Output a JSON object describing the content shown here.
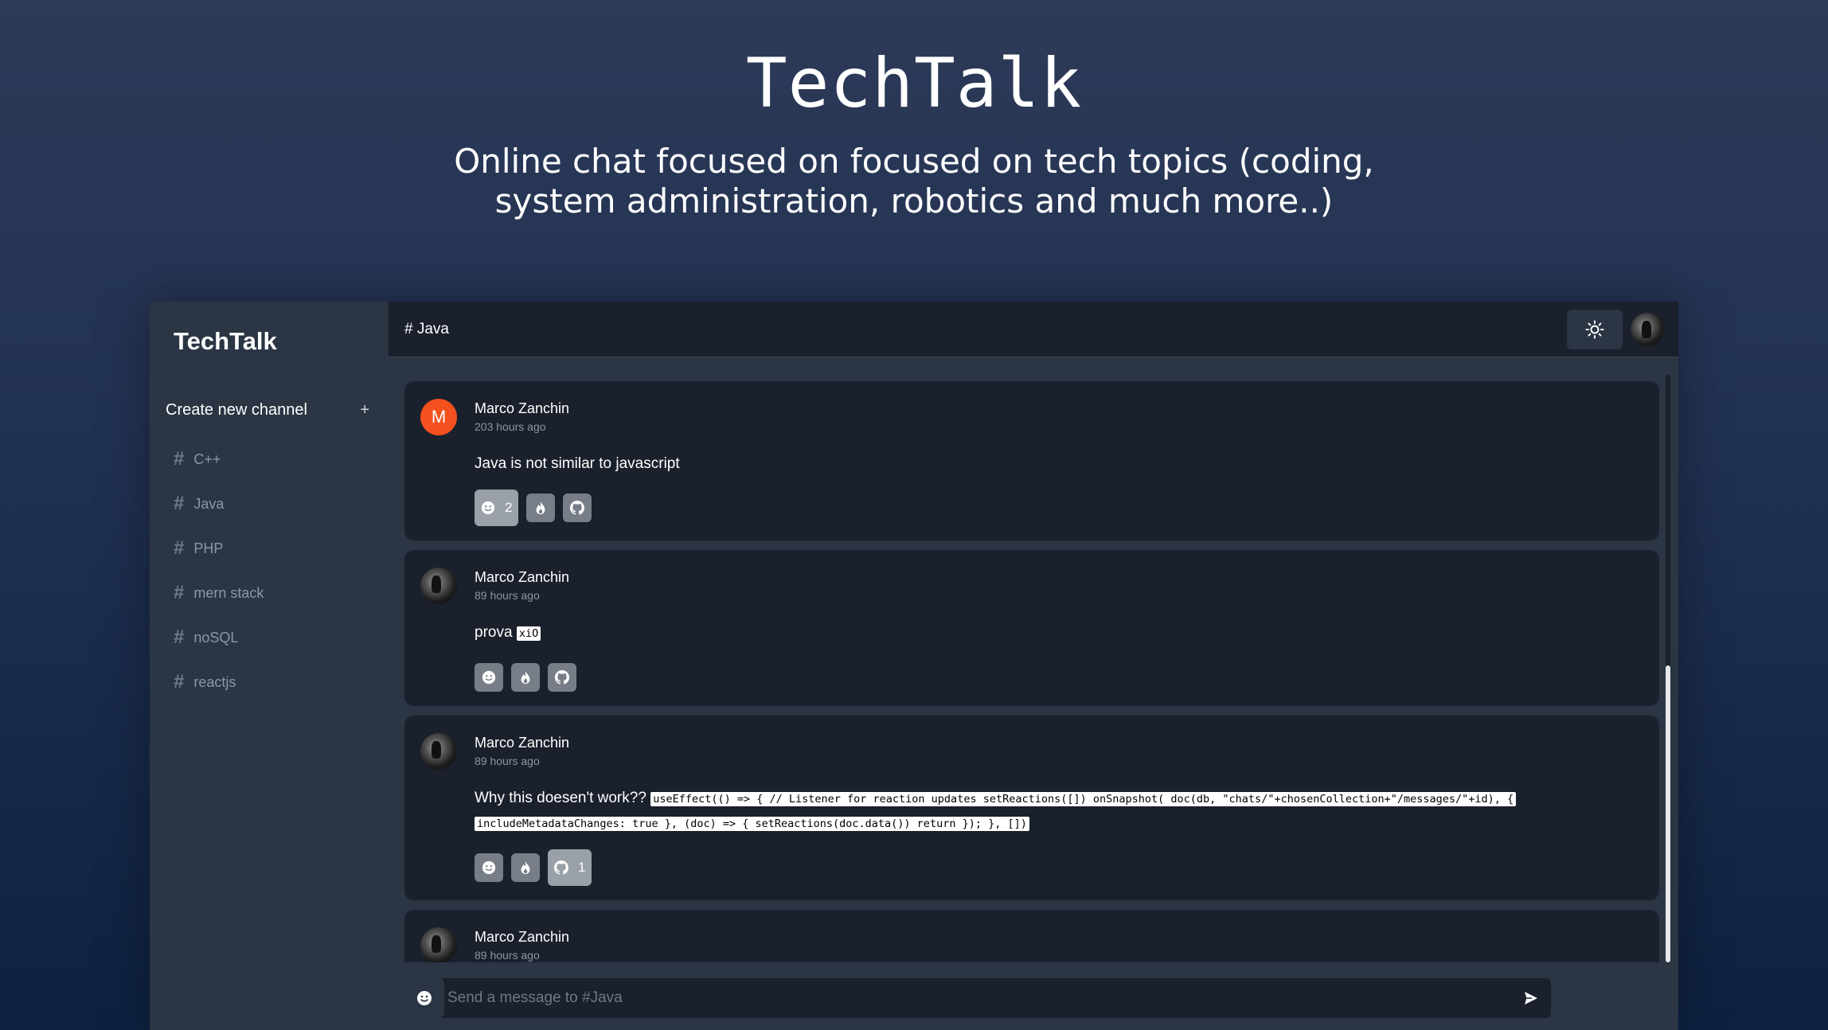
{
  "hero": {
    "title": "TechTalk",
    "subtitle": "Online chat focused on focused on tech topics (coding, system administration, robotics and much more..)"
  },
  "sidebar": {
    "brand": "TechTalk",
    "create_label": "Create new channel",
    "create_icon": "+",
    "channels": [
      {
        "hash": "#",
        "label": "C++"
      },
      {
        "hash": "#",
        "label": "Java"
      },
      {
        "hash": "#",
        "label": "PHP"
      },
      {
        "hash": "#",
        "label": "mern stack"
      },
      {
        "hash": "#",
        "label": "noSQL"
      },
      {
        "hash": "#",
        "label": "reactjs"
      }
    ]
  },
  "topbar": {
    "channel": "# Java",
    "theme_icon": "sun-icon"
  },
  "messages": [
    {
      "avatar_letter": "M",
      "author": "Marco Zanchin",
      "time": "203 hours ago",
      "text": "Java is not similar to javascript",
      "reactions": [
        {
          "icon": "smile-icon",
          "count": "2"
        },
        {
          "icon": "fire-icon",
          "count": ""
        },
        {
          "icon": "github-icon",
          "count": ""
        }
      ]
    },
    {
      "author": "Marco Zanchin",
      "time": "89 hours ago",
      "text": "prova",
      "code": "xiO",
      "reactions": [
        {
          "icon": "smile-icon",
          "count": ""
        },
        {
          "icon": "fire-icon",
          "count": ""
        },
        {
          "icon": "github-icon",
          "count": ""
        }
      ]
    },
    {
      "author": "Marco Zanchin",
      "time": "89 hours ago",
      "text": "Why this doesen't work??",
      "code": "useEffect(() => { // Listener for reaction updates setReactions([]) onSnapshot( doc(db, \"chats/\"+chosenCollection+\"/messages/\"+id), { includeMetadataChanges: true }, (doc) => { setReactions(doc.data()) return }); }, [])",
      "reactions": [
        {
          "icon": "smile-icon",
          "count": ""
        },
        {
          "icon": "fire-icon",
          "count": ""
        },
        {
          "icon": "github-icon",
          "count": "1"
        }
      ]
    },
    {
      "author": "Marco Zanchin",
      "time": "89 hours ago"
    }
  ],
  "composer": {
    "placeholder": "Send a message to #Java",
    "value": ""
  }
}
